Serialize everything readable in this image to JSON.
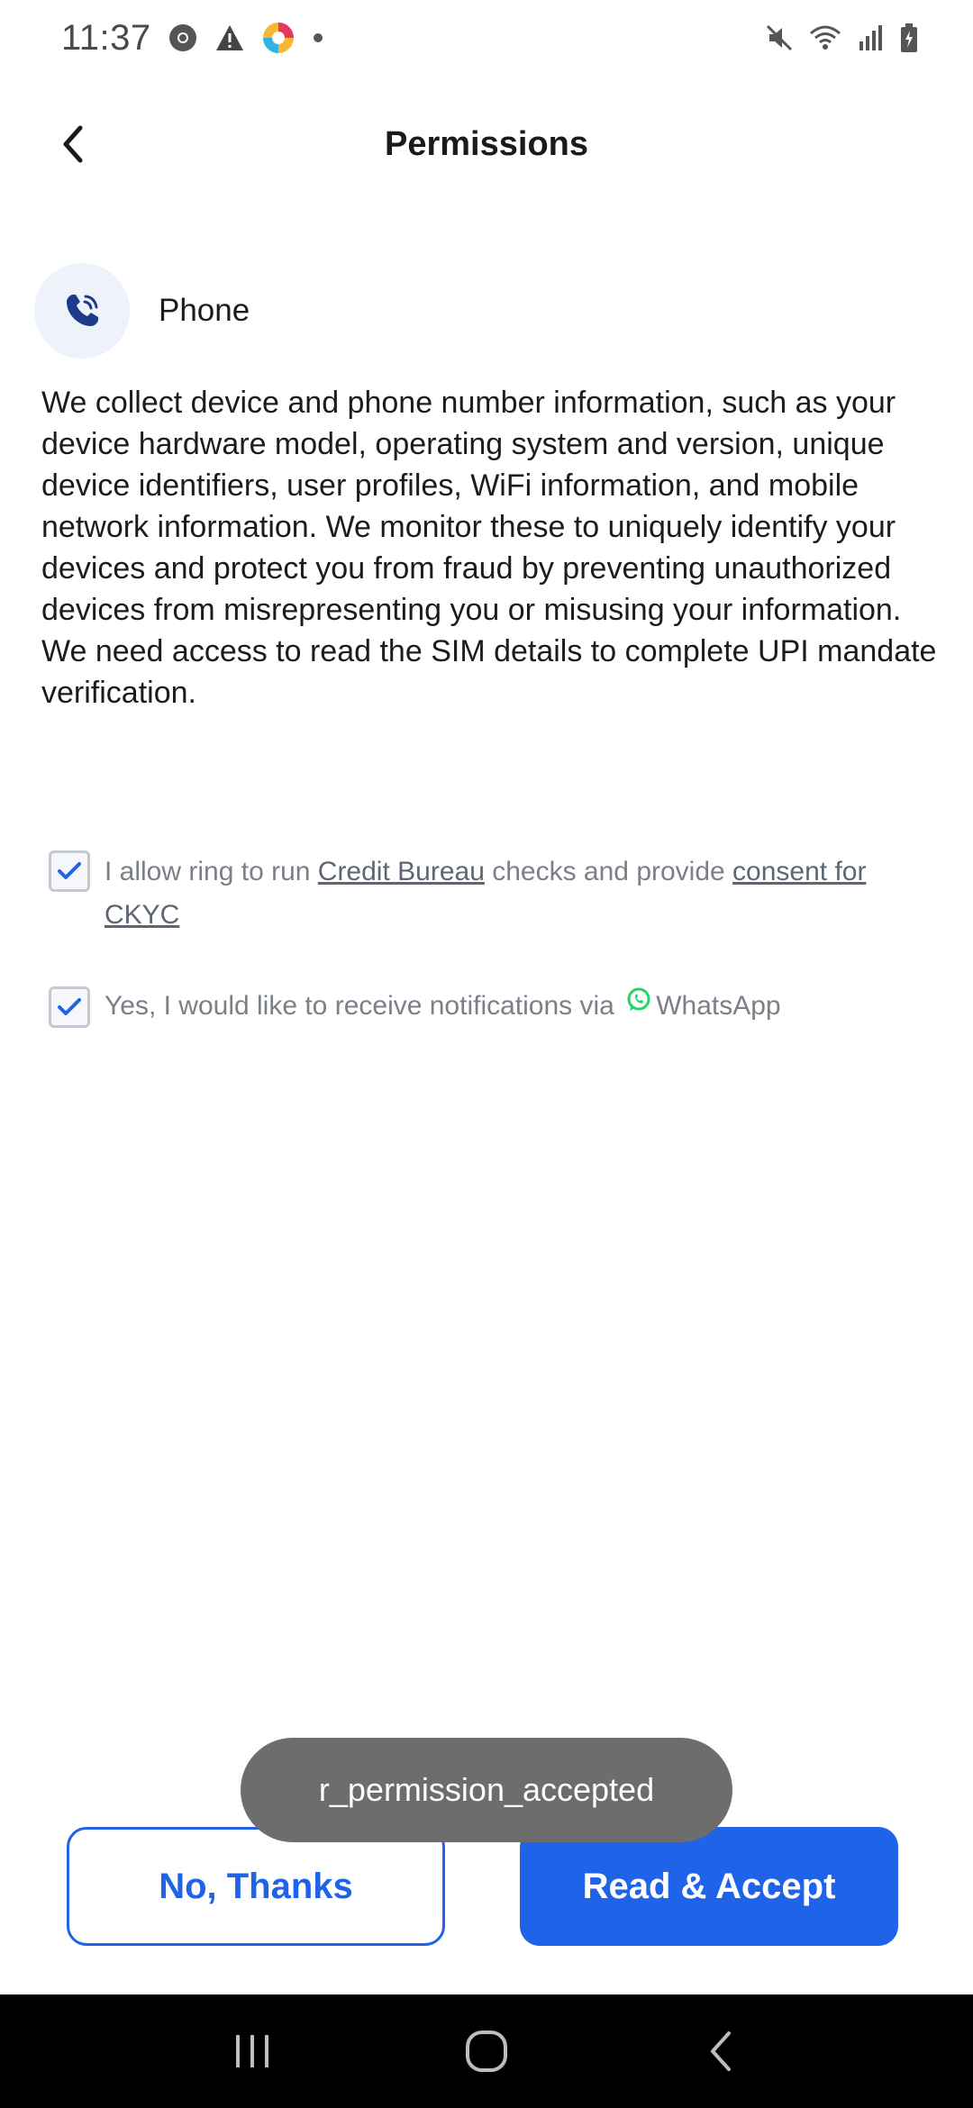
{
  "status_bar": {
    "time": "11:37",
    "left_icons": [
      "chrome-icon",
      "warning-icon",
      "app-icon",
      "dot-icon"
    ],
    "right_icons": [
      "mute-icon",
      "wifi-icon",
      "signal-icon",
      "battery-icon"
    ]
  },
  "header": {
    "title": "Permissions"
  },
  "permission": {
    "label": "Phone",
    "icon": "phone-icon",
    "description_p1": "We collect device and phone number information, such as your device hardware model, operating system and version, unique device identifiers, user profiles, WiFi information, and mobile network information. We monitor these to uniquely identify your devices and protect you from fraud by preventing unauthorized devices from misrepresenting you or misusing your information.",
    "description_p2": "We need access to read the SIM details to complete UPI mandate verification."
  },
  "consents": {
    "bureau": {
      "checked": true,
      "prefix": " I allow ring to run ",
      "link1": "Credit Bureau",
      "middle": " checks and provide ",
      "link2": "consent for CKYC"
    },
    "whatsapp": {
      "checked": true,
      "prefix": "Yes, I would like to receive notifications via",
      "suffix": "WhatsApp"
    }
  },
  "toast": {
    "text": "r_permission_accepted"
  },
  "buttons": {
    "decline": "No, Thanks",
    "accept": "Read & Accept"
  },
  "colors": {
    "accent": "#1f63e8",
    "whatsapp": "#25d366",
    "toast_bg": "#6d6d6d"
  }
}
